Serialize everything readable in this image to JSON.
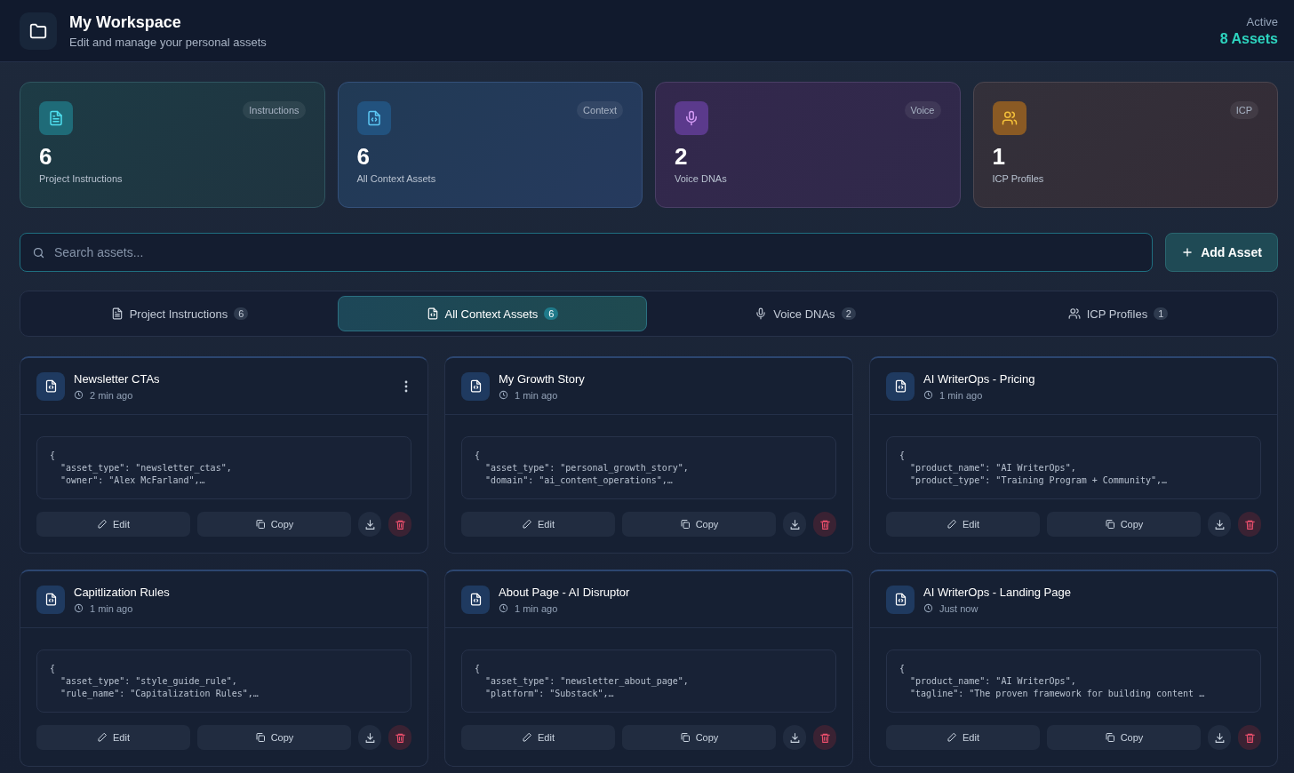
{
  "header": {
    "title": "My Workspace",
    "subtitle": "Edit and manage your personal assets",
    "status_label": "Active",
    "status_value": "8 Assets"
  },
  "stats": [
    {
      "kind": "instructions",
      "tag": "Instructions",
      "count": "6",
      "label": "Project Instructions"
    },
    {
      "kind": "context",
      "tag": "Context",
      "count": "6",
      "label": "All Context Assets"
    },
    {
      "kind": "voice",
      "tag": "Voice",
      "count": "2",
      "label": "Voice DNAs"
    },
    {
      "kind": "icp",
      "tag": "ICP",
      "count": "1",
      "label": "ICP Profiles"
    }
  ],
  "search": {
    "placeholder": "Search assets..."
  },
  "add_button": {
    "label": "Add Asset"
  },
  "tabs": [
    {
      "kind": "instructions",
      "label": "Project Instructions",
      "count": "6",
      "selected": false
    },
    {
      "kind": "context",
      "label": "All Context Assets",
      "count": "6",
      "selected": true
    },
    {
      "kind": "voice",
      "label": "Voice DNAs",
      "count": "2",
      "selected": false
    },
    {
      "kind": "icp",
      "label": "ICP Profiles",
      "count": "1",
      "selected": false
    }
  ],
  "assets": [
    {
      "title": "Newsletter CTAs",
      "time": "2 min ago",
      "menu_visible": true,
      "code": [
        "{",
        "  \"asset_type\": \"newsletter_ctas\",",
        "  \"owner\": \"Alex McFarland\",…"
      ],
      "edit": "Edit",
      "copy": "Copy"
    },
    {
      "title": "My Growth Story",
      "time": "1 min ago",
      "menu_visible": false,
      "code": [
        "{",
        "  \"asset_type\": \"personal_growth_story\",",
        "  \"domain\": \"ai_content_operations\",…"
      ],
      "edit": "Edit",
      "copy": "Copy"
    },
    {
      "title": "AI WriterOps - Pricing",
      "time": "1 min ago",
      "menu_visible": false,
      "code": [
        "{",
        "  \"product_name\": \"AI WriterOps\",",
        "  \"product_type\": \"Training Program + Community\",…"
      ],
      "edit": "Edit",
      "copy": "Copy"
    },
    {
      "title": "Capitlization Rules",
      "time": "1 min ago",
      "menu_visible": false,
      "code": [
        "{",
        "  \"asset_type\": \"style_guide_rule\",",
        "  \"rule_name\": \"Capitalization Rules\",…"
      ],
      "edit": "Edit",
      "copy": "Copy"
    },
    {
      "title": "About Page - AI Disruptor",
      "time": "1 min ago",
      "menu_visible": false,
      "code": [
        "{",
        "  \"asset_type\": \"newsletter_about_page\",",
        "  \"platform\": \"Substack\",…"
      ],
      "edit": "Edit",
      "copy": "Copy"
    },
    {
      "title": "AI WriterOps - Landing Page",
      "time": "Just now",
      "menu_visible": false,
      "code": [
        "{",
        "  \"product_name\": \"AI WriterOps\",",
        "  \"tagline\": \"The proven framework for building content …"
      ],
      "edit": "Edit",
      "copy": "Copy"
    }
  ]
}
